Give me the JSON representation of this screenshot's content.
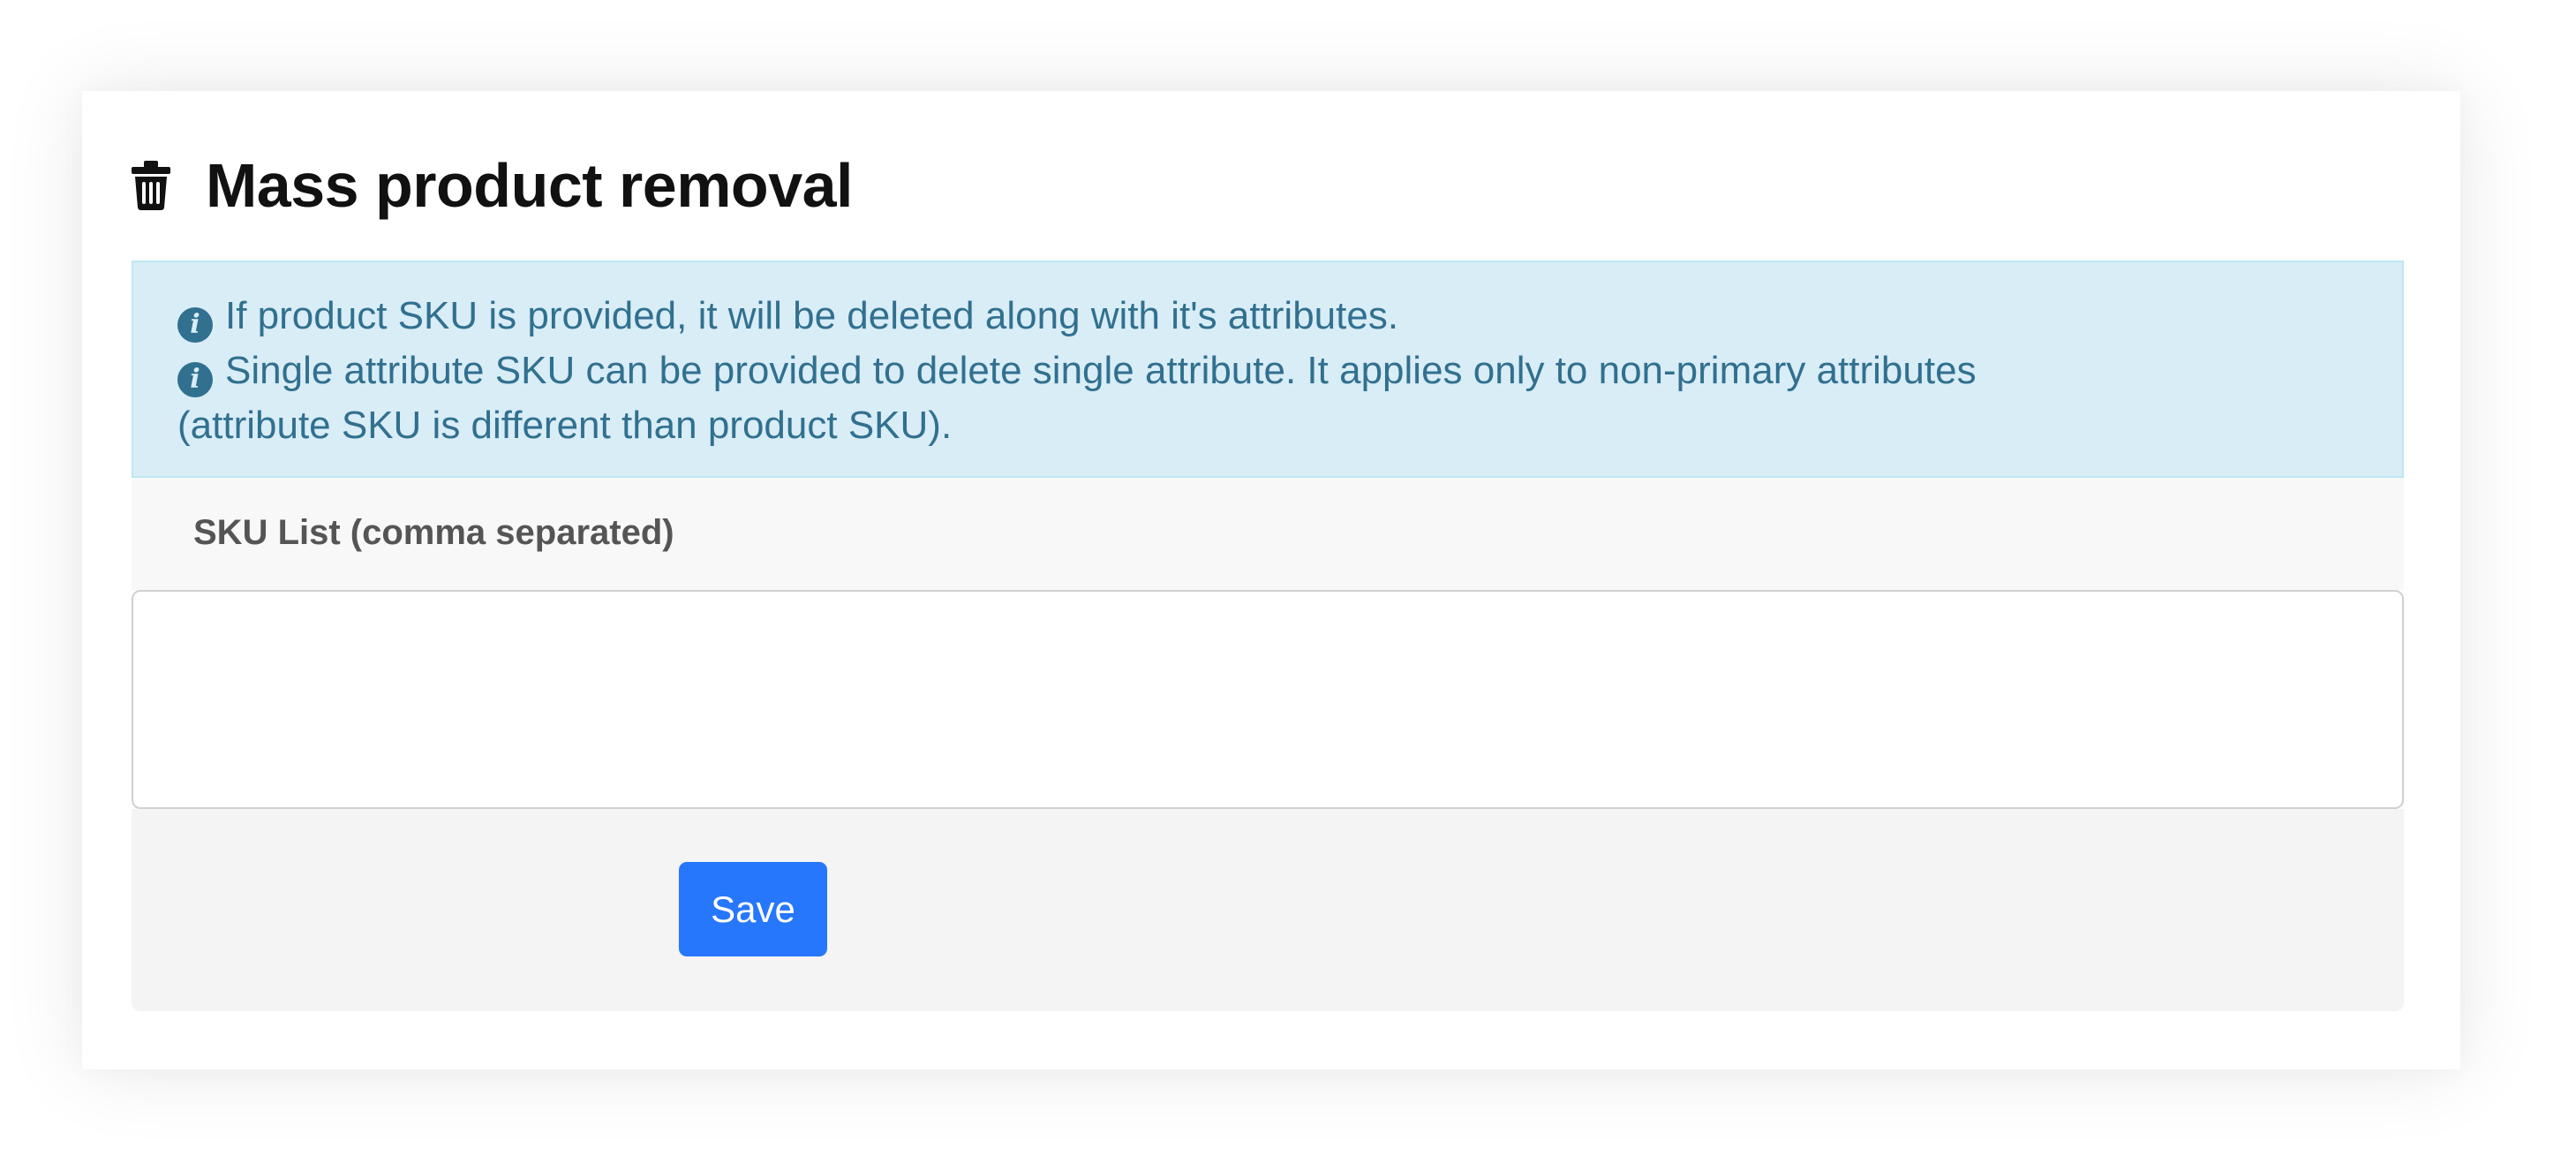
{
  "header": {
    "icon": "trash-icon",
    "title": "Mass product removal"
  },
  "info": {
    "icon": "info-circle-icon",
    "accent_color": "#31708f",
    "background_color": "#d9edf7",
    "line1": "If product SKU is provided, it will be deleted along with it's attributes.",
    "line2": "Single attribute SKU can be provided to delete single attribute. It applies only to non-primary attributes",
    "line3": "(attribute SKU is different than product SKU)."
  },
  "form": {
    "sku_label": "SKU List (comma separated)",
    "sku_value": "",
    "save_label": "Save",
    "save_color": "#2677fb"
  }
}
